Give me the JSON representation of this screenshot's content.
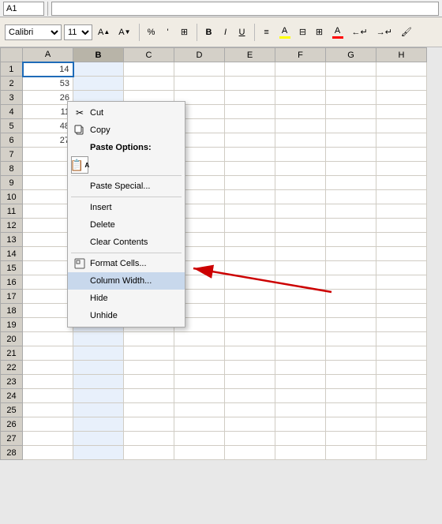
{
  "namebox": {
    "value": "A1"
  },
  "formulabar": {
    "value": ""
  },
  "ribbon": {
    "font": "Calibri",
    "size": "11",
    "bold": "B",
    "italic": "I",
    "underline": "U"
  },
  "columns": [
    "",
    "A",
    "B",
    "C",
    "D",
    "E",
    "F",
    "G",
    "H"
  ],
  "rows": [
    [
      "1",
      "14",
      "",
      "",
      "",
      "",
      "",
      "",
      ""
    ],
    [
      "2",
      "53",
      "",
      "",
      "",
      "",
      "",
      "",
      ""
    ],
    [
      "3",
      "26",
      "",
      "",
      "",
      "",
      "",
      "",
      ""
    ],
    [
      "4",
      "11",
      "",
      "",
      "",
      "",
      "",
      "",
      ""
    ],
    [
      "5",
      "48",
      "",
      "",
      "",
      "",
      "",
      "",
      ""
    ],
    [
      "6",
      "27",
      "",
      "",
      "",
      "",
      "",
      "",
      ""
    ],
    [
      "7",
      "",
      "",
      "",
      "",
      "",
      "",
      "",
      ""
    ],
    [
      "8",
      "",
      "",
      "",
      "",
      "",
      "",
      "",
      ""
    ],
    [
      "9",
      "",
      "",
      "",
      "",
      "",
      "",
      "",
      ""
    ],
    [
      "10",
      "",
      "",
      "",
      "",
      "",
      "",
      "",
      ""
    ],
    [
      "11",
      "",
      "",
      "",
      "",
      "",
      "",
      "",
      ""
    ],
    [
      "12",
      "",
      "",
      "",
      "",
      "",
      "",
      "",
      ""
    ],
    [
      "13",
      "",
      "",
      "",
      "",
      "",
      "",
      "",
      ""
    ],
    [
      "14",
      "",
      "",
      "",
      "",
      "",
      "",
      "",
      ""
    ],
    [
      "15",
      "",
      "",
      "",
      "",
      "",
      "",
      "",
      ""
    ],
    [
      "16",
      "",
      "",
      "",
      "",
      "",
      "",
      "",
      ""
    ],
    [
      "17",
      "",
      "",
      "",
      "",
      "",
      "",
      "",
      ""
    ],
    [
      "18",
      "",
      "",
      "",
      "",
      "",
      "",
      "",
      ""
    ],
    [
      "19",
      "",
      "",
      "",
      "",
      "",
      "",
      "",
      ""
    ],
    [
      "20",
      "",
      "",
      "",
      "",
      "",
      "",
      "",
      ""
    ],
    [
      "21",
      "",
      "",
      "",
      "",
      "",
      "",
      "",
      ""
    ],
    [
      "22",
      "",
      "",
      "",
      "",
      "",
      "",
      "",
      ""
    ],
    [
      "23",
      "",
      "",
      "",
      "",
      "",
      "",
      "",
      ""
    ],
    [
      "24",
      "",
      "",
      "",
      "",
      "",
      "",
      "",
      ""
    ],
    [
      "25",
      "",
      "",
      "",
      "",
      "",
      "",
      "",
      ""
    ],
    [
      "26",
      "",
      "",
      "",
      "",
      "",
      "",
      "",
      ""
    ],
    [
      "27",
      "",
      "",
      "",
      "",
      "",
      "",
      "",
      ""
    ],
    [
      "28",
      "",
      "",
      "",
      "",
      "",
      "",
      "",
      ""
    ]
  ],
  "contextMenu": {
    "items": [
      {
        "id": "cut",
        "label": "Cut",
        "icon": "✂",
        "hasSep": false
      },
      {
        "id": "copy",
        "label": "Copy",
        "icon": "⧉",
        "hasSep": false
      },
      {
        "id": "paste-options",
        "label": "Paste Options:",
        "icon": "",
        "hasSep": false,
        "isHeader": true
      },
      {
        "id": "paste-icon",
        "label": "",
        "icon": "📋",
        "hasSep": false,
        "isPasteIcon": true
      },
      {
        "id": "paste-special",
        "label": "Paste Special...",
        "icon": "",
        "hasSep": true
      },
      {
        "id": "insert",
        "label": "Insert",
        "icon": "",
        "hasSep": false
      },
      {
        "id": "delete",
        "label": "Delete",
        "icon": "",
        "hasSep": false
      },
      {
        "id": "clear-contents",
        "label": "Clear Contents",
        "icon": "",
        "hasSep": false
      },
      {
        "id": "format-cells",
        "label": "Format Cells...",
        "icon": "⊞",
        "hasSep": false
      },
      {
        "id": "column-width",
        "label": "Column Width...",
        "icon": "",
        "hasSep": false,
        "highlighted": true
      },
      {
        "id": "hide",
        "label": "Hide",
        "icon": "",
        "hasSep": false
      },
      {
        "id": "unhide",
        "label": "Unhide",
        "icon": "",
        "hasSep": false
      }
    ]
  },
  "arrow": {
    "label": "arrow pointing to Column Width menu item"
  }
}
